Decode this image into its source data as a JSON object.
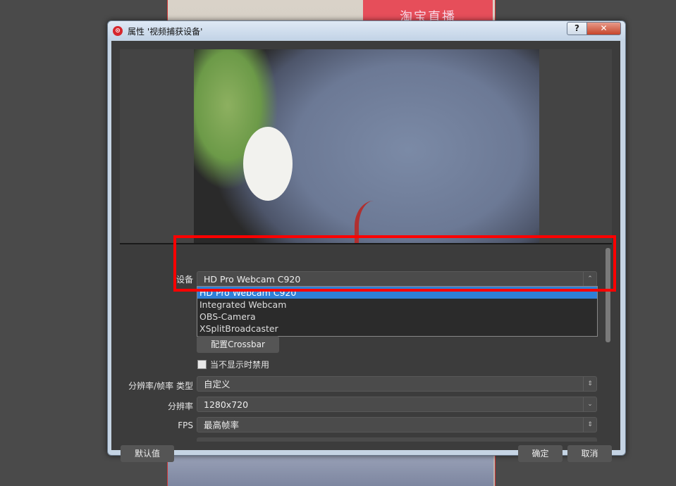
{
  "window": {
    "title": "属性 '视频捕获设备'",
    "help_label": "?",
    "close_label": "✕"
  },
  "background": {
    "banner_text": "淘宝直播"
  },
  "form": {
    "device": {
      "label": "设备",
      "value": "HD Pro Webcam C920",
      "options": [
        "HD Pro Webcam C920",
        "Integrated Webcam",
        "OBS-Camera",
        "XSplitBroadcaster"
      ],
      "selected_index": 0
    },
    "crossbar_button": "配置Crossbar",
    "disable_when_hidden": {
      "label": "当不显示时禁用",
      "checked": false
    },
    "res_fps_type": {
      "label": "分辨率/帧率 类型",
      "value": "自定义"
    },
    "resolution": {
      "label": "分辨率",
      "value": "1280x720"
    },
    "fps": {
      "label": "FPS",
      "value": "最高帧率"
    }
  },
  "footer": {
    "defaults_button": "默认值",
    "ok_button": "确定",
    "cancel_button": "取消"
  },
  "colors": {
    "highlight": "#ff0000",
    "selected_item": "#2f7fd6",
    "panel": "#3c3c3c"
  }
}
